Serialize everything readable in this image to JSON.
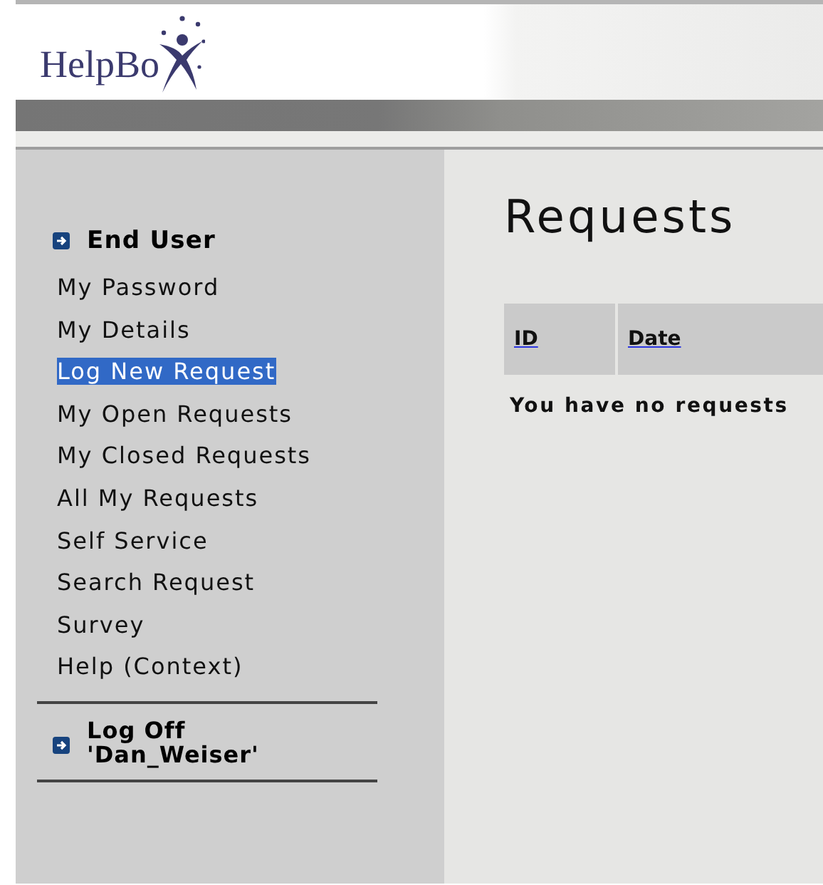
{
  "logo": {
    "text": "HelpBo"
  },
  "sidebar": {
    "section_title": "End User",
    "items": [
      {
        "label": "My Password",
        "selected": false
      },
      {
        "label": "My Details",
        "selected": false
      },
      {
        "label": "Log New Request",
        "selected": true
      },
      {
        "label": "My Open Requests",
        "selected": false
      },
      {
        "label": "My Closed Requests",
        "selected": false
      },
      {
        "label": "All My Requests",
        "selected": false
      },
      {
        "label": "Self Service",
        "selected": false
      },
      {
        "label": "Search Request",
        "selected": false
      },
      {
        "label": "Survey",
        "selected": false
      },
      {
        "label": "Help (Context)",
        "selected": false
      }
    ],
    "log_off": {
      "line_1": "Log Off",
      "line_2": "'Dan_Weiser'"
    }
  },
  "main": {
    "title": "Requests",
    "table": {
      "columns": [
        "ID",
        "Date"
      ],
      "empty_message": "You have no requests"
    }
  }
}
